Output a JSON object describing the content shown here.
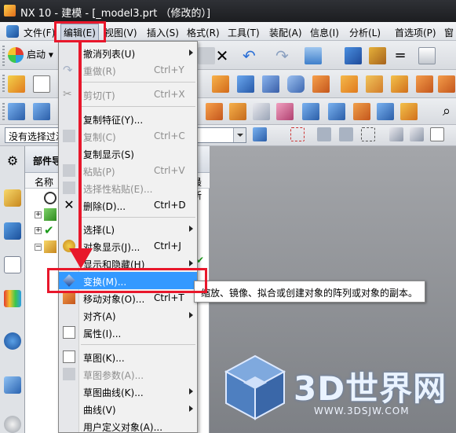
{
  "window": {
    "title": "NX 10 - 建模 - [_model3.prt （修改的）]"
  },
  "menubar": {
    "items": [
      {
        "label": "文件(F)"
      },
      {
        "label": "编辑(E)"
      },
      {
        "label": "视图(V)"
      },
      {
        "label": "插入(S)"
      },
      {
        "label": "格式(R)"
      },
      {
        "label": "工具(T)"
      },
      {
        "label": "装配(A)"
      },
      {
        "label": "信息(I)"
      },
      {
        "label": "分析(L)"
      },
      {
        "label": "首选项(P)"
      },
      {
        "label": "窗"
      }
    ]
  },
  "toolbar": {
    "start_label": "启动"
  },
  "filter": {
    "value": "没有选择过滤"
  },
  "navigator": {
    "title": "部件导",
    "col_name": "名称",
    "col_latest": "最新"
  },
  "edit_menu": {
    "items": [
      {
        "label": "撤消列表(U)",
        "shortcut": "",
        "submenu": true,
        "enabled": true,
        "icon": "none"
      },
      {
        "label": "重做(R)",
        "shortcut": "Ctrl+Y",
        "submenu": false,
        "enabled": false,
        "icon": "redo-icon"
      },
      {
        "label": "剪切(T)",
        "shortcut": "Ctrl+X",
        "submenu": false,
        "enabled": false,
        "icon": "cut-icon"
      },
      {
        "label": "复制特征(Y)...",
        "shortcut": "",
        "submenu": false,
        "enabled": true,
        "icon": "none"
      },
      {
        "label": "复制(C)",
        "shortcut": "Ctrl+C",
        "submenu": false,
        "enabled": false,
        "icon": "copy-icon"
      },
      {
        "label": "复制显示(S)",
        "shortcut": "",
        "submenu": false,
        "enabled": true,
        "icon": "none"
      },
      {
        "label": "粘贴(P)",
        "shortcut": "Ctrl+V",
        "submenu": false,
        "enabled": false,
        "icon": "paste-icon"
      },
      {
        "label": "选择性粘贴(E)...",
        "shortcut": "",
        "submenu": false,
        "enabled": false,
        "icon": "paste-special-icon"
      },
      {
        "label": "删除(D)...",
        "shortcut": "Ctrl+D",
        "submenu": false,
        "enabled": true,
        "icon": "delete-icon"
      },
      {
        "label": "选择(L)",
        "shortcut": "",
        "submenu": true,
        "enabled": true,
        "icon": "none"
      },
      {
        "label": "对象显示(J)...",
        "shortcut": "Ctrl+J",
        "submenu": false,
        "enabled": true,
        "icon": "object-display-icon"
      },
      {
        "label": "显示和隐藏(H)",
        "shortcut": "",
        "submenu": true,
        "enabled": true,
        "icon": "none"
      },
      {
        "label": "变换(M)...",
        "shortcut": "",
        "submenu": false,
        "enabled": true,
        "icon": "transform-icon",
        "highlighted": true
      },
      {
        "label": "移动对象(O)...",
        "shortcut": "Ctrl+T",
        "submenu": false,
        "enabled": true,
        "icon": "move-object-icon"
      },
      {
        "label": "对齐(A)",
        "shortcut": "",
        "submenu": true,
        "enabled": true,
        "icon": "none"
      },
      {
        "label": "属性(I)...",
        "shortcut": "",
        "submenu": false,
        "enabled": true,
        "icon": "properties-icon"
      },
      {
        "label": "草图(K)...",
        "shortcut": "",
        "submenu": false,
        "enabled": true,
        "icon": "sketch-icon"
      },
      {
        "label": "草图参数(A)...",
        "shortcut": "",
        "submenu": false,
        "enabled": false,
        "icon": "sketch-params-icon"
      },
      {
        "label": "草图曲线(K)...",
        "shortcut": "",
        "submenu": true,
        "enabled": true,
        "icon": "none"
      },
      {
        "label": "曲线(V)",
        "shortcut": "",
        "submenu": true,
        "enabled": true,
        "icon": "none"
      },
      {
        "label": "用户定义对象(A)...",
        "shortcut": "",
        "submenu": false,
        "enabled": true,
        "icon": "none"
      }
    ]
  },
  "tooltip": {
    "text": "缩放、镜像、拟合或创建对象的阵列或对象的副本。"
  },
  "watermark": {
    "brand": "3D世界网",
    "url": "WWW.3DSJW.COM"
  },
  "colors": {
    "highlight": "#3399ff",
    "annotation": "#e8172b"
  }
}
